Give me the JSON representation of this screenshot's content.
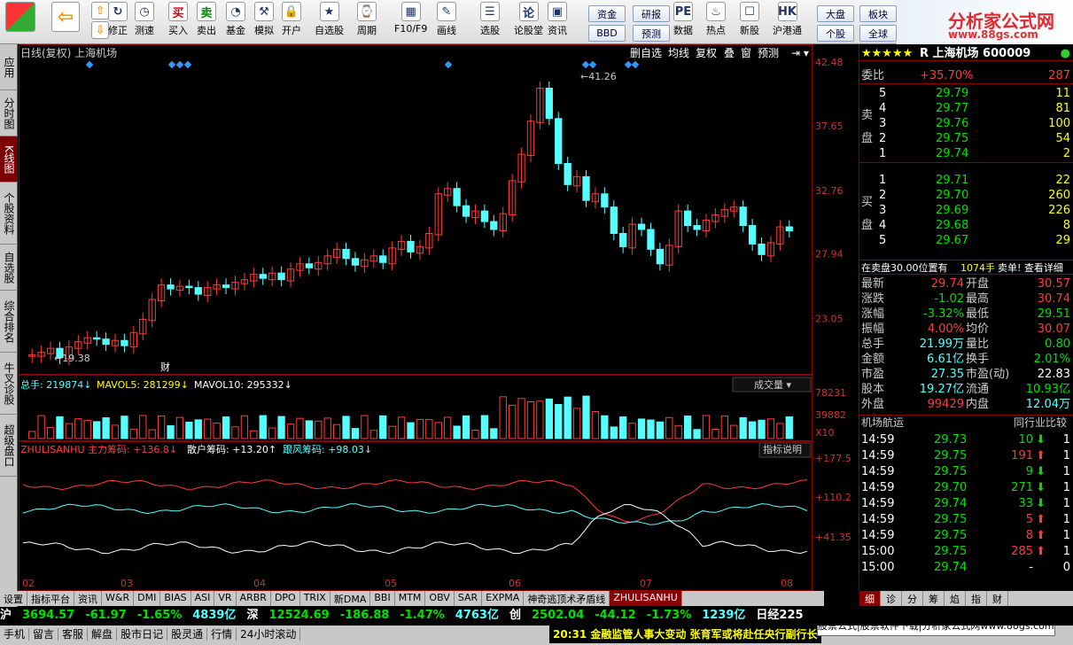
{
  "toolbar": {
    "buttons": [
      "修正",
      "测速",
      "买入",
      "卖出",
      "基金",
      "模拟",
      "开户",
      "自选股",
      "周期",
      "F10/F9",
      "画线",
      "选股",
      "论股堂",
      "资讯",
      "数据",
      "热点",
      "新股",
      "沪港通"
    ],
    "small": [
      "资金",
      "BBD",
      "研报",
      "预测",
      "大盘",
      "个股",
      "板块",
      "全球"
    ]
  },
  "brand": {
    "name": "分析家公式网",
    "url": "www.88gs.com"
  },
  "left_tabs": [
    "应用",
    "分时图",
    "K线图",
    "个股资料",
    "自选股",
    "综合排名",
    "牛叉诊股",
    "超级盘口"
  ],
  "chart": {
    "title": "日线(复权) 上海机场",
    "buttons": [
      "删自选",
      "均线",
      "复权",
      "叠",
      "窗",
      "预测"
    ],
    "price_ticks": [
      "42.48",
      "37.65",
      "32.76",
      "27.94",
      "23.05"
    ],
    "max_label": "41.26",
    "min_label": "19.38",
    "fin_mark": "财",
    "vol_line": {
      "lbl": "总手:",
      "v": "219874",
      "m5lbl": "MAVOL5:",
      "m5": "281299",
      "m10lbl": "MAVOL10:",
      "m10": "295332"
    },
    "vol_ticks": [
      "78231",
      "39882",
      "X10"
    ],
    "vol_btn": "成交量",
    "ind_line": {
      "name": "ZHULISANHU",
      "a": "主力筹码:",
      "av": "+136.8",
      "b": "散户筹码:",
      "bv": "+13.20",
      "c": "跟风筹码:",
      "cv": "+98.03"
    },
    "ind_ticks": [
      "+177.5",
      "+110.2",
      "+41.35"
    ],
    "ind_btn": "指标说明",
    "months": [
      "02",
      "03",
      "04",
      "05",
      "06",
      "07",
      "08"
    ]
  },
  "chart_data": [
    {
      "type": "candlestick",
      "title": "日线(复权) 上海机场",
      "xlabel": "",
      "ylabel": "",
      "x": [
        "02",
        "03",
        "04",
        "05",
        "06",
        "07",
        "08"
      ],
      "ylim": [
        19.38,
        42.48
      ],
      "series": [
        {
          "values": [
            20.5,
            21.5,
            22.4,
            25.6,
            26.2,
            26.8,
            27.2,
            28.2,
            33.0,
            31.8,
            35.5,
            41.26,
            34.5,
            30.0,
            29.2,
            26.0,
            28.5,
            29.7
          ]
        }
      ]
    }
  ],
  "side": {
    "header": "R 上海机场 600009",
    "wb": "委比",
    "wbv": "+35.70%",
    "wbn": "287",
    "sell": "卖盘",
    "buy": "买盘",
    "asks": [
      [
        "5",
        "29.79",
        "11"
      ],
      [
        "4",
        "29.77",
        "81"
      ],
      [
        "3",
        "29.76",
        "100"
      ],
      [
        "2",
        "29.75",
        "54"
      ],
      [
        "1",
        "29.74",
        "2"
      ]
    ],
    "bids": [
      [
        "1",
        "29.71",
        "22"
      ],
      [
        "2",
        "29.70",
        "260"
      ],
      [
        "3",
        "29.69",
        "226"
      ],
      [
        "4",
        "29.68",
        "8"
      ],
      [
        "5",
        "29.67",
        "29"
      ]
    ],
    "note": "在卖盘30.00位置有",
    "note2": "1074手",
    "note3": "卖单! 查看详细",
    "stats": [
      [
        "最新",
        "29.74",
        "开盘",
        "30.57"
      ],
      [
        "涨跌",
        "-1.02",
        "最高",
        "30.74"
      ],
      [
        "涨幅",
        "-3.32%",
        "最低",
        "29.51"
      ],
      [
        "振幅",
        "4.00%",
        "均价",
        "30.07"
      ],
      [
        "总手",
        "21.99万",
        "量比",
        "0.80"
      ],
      [
        "金额",
        "6.61亿",
        "换手",
        "2.01%"
      ],
      [
        "市盈",
        "27.35",
        "市盈(动)",
        "22.83"
      ],
      [
        "股本",
        "19.27亿",
        "流通",
        "10.93亿"
      ],
      [
        "外盘",
        "99429",
        "内盘",
        "12.04万"
      ]
    ],
    "tab1": "机场航运",
    "tab2": "同行业比较",
    "ticks": [
      [
        "14:59",
        "29.73",
        "10",
        "1"
      ],
      [
        "14:59",
        "29.75",
        "191",
        "1"
      ],
      [
        "14:59",
        "29.75",
        "9",
        "1"
      ],
      [
        "14:59",
        "29.70",
        "271",
        "1"
      ],
      [
        "14:59",
        "29.74",
        "33",
        "1"
      ],
      [
        "14:59",
        "29.75",
        "5",
        "1"
      ],
      [
        "14:59",
        "29.75",
        "8",
        "1"
      ],
      [
        "15:00",
        "29.75",
        "285",
        "1"
      ],
      [
        "15:00",
        "29.74",
        "-",
        "0"
      ]
    ],
    "btabs": [
      "细",
      "诊",
      "分",
      "筹",
      "焰",
      "指",
      "财"
    ]
  },
  "bottom_tabs": [
    "设置",
    "指标平台",
    "资讯",
    "W&R",
    "DMI",
    "BIAS",
    "ASI",
    "VR",
    "ARBR",
    "DPO",
    "TRIX",
    "新DMA",
    "BBI",
    "MTM",
    "OBV",
    "SAR",
    "EXPMA",
    "神奇逃顶术矛盾线",
    "ZHULISANHU"
  ],
  "index_bar": {
    "sh": "沪",
    "shv": "3694.57",
    "shc": "-61.97",
    "shp": "-1.65%",
    "sha": "4839亿",
    "sz": "深",
    "szv": "12524.69",
    "szc": "-186.88",
    "szp": "-1.47%",
    "sza": "4763亿",
    "cy": "创",
    "cyv": "2502.04",
    "cyc": "-44.12",
    "cyp": "-1.73%",
    "cya": "1239亿",
    "rj": "日经225"
  },
  "status": {
    "items": [
      "手机",
      "留言",
      "客服",
      "解盘",
      "股市日记",
      "股灵通",
      "行情",
      "24小时滚动"
    ],
    "news": "20:31 金融监管人事大变动 张育军或将赴任央行副行长",
    "promo": "股票公式|股票软件下载|分析家公式网www.88gs.com"
  }
}
